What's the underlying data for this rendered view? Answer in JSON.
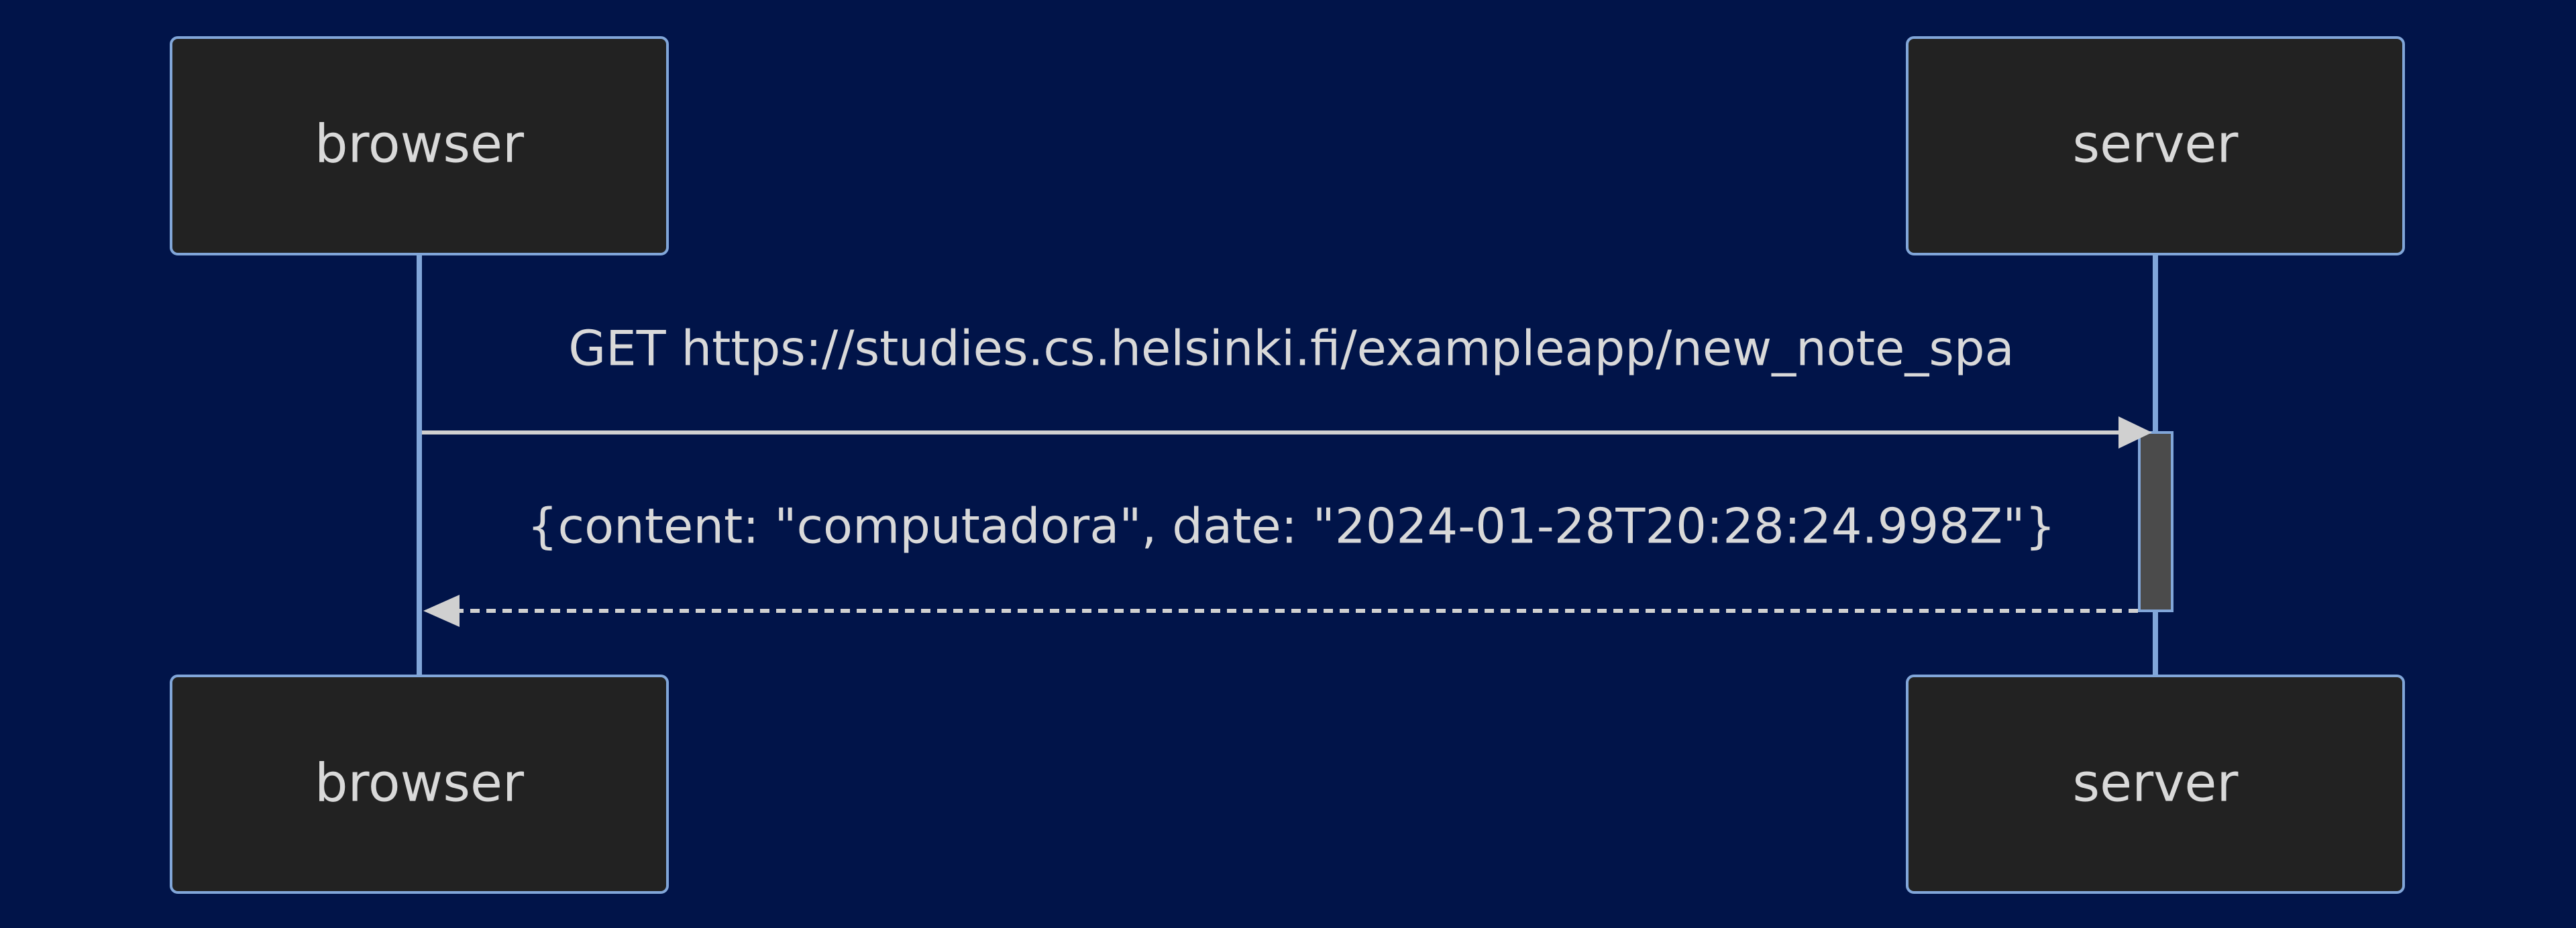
{
  "diagram": {
    "type": "sequence",
    "colors": {
      "background": "#011449",
      "actor_fill": "#222222",
      "actor_border": "#81a6d9",
      "lifeline": "#81a6d9",
      "arrow": "#d0d0d0",
      "text": "#d9d9d9",
      "activation_fill": "#4b4b4b"
    },
    "participants": [
      {
        "id": "browser",
        "label": "browser"
      },
      {
        "id": "server",
        "label": "server"
      }
    ],
    "messages": [
      {
        "from": "browser",
        "to": "server",
        "style": "solid",
        "text": "GET https://studies.cs.helsinki.fi/exampleapp/new_note_spa"
      },
      {
        "from": "server",
        "to": "browser",
        "style": "dashed",
        "text": "{content: \"computadora\", date: \"2024-01-28T20:28:24.998Z\"}"
      }
    ]
  }
}
